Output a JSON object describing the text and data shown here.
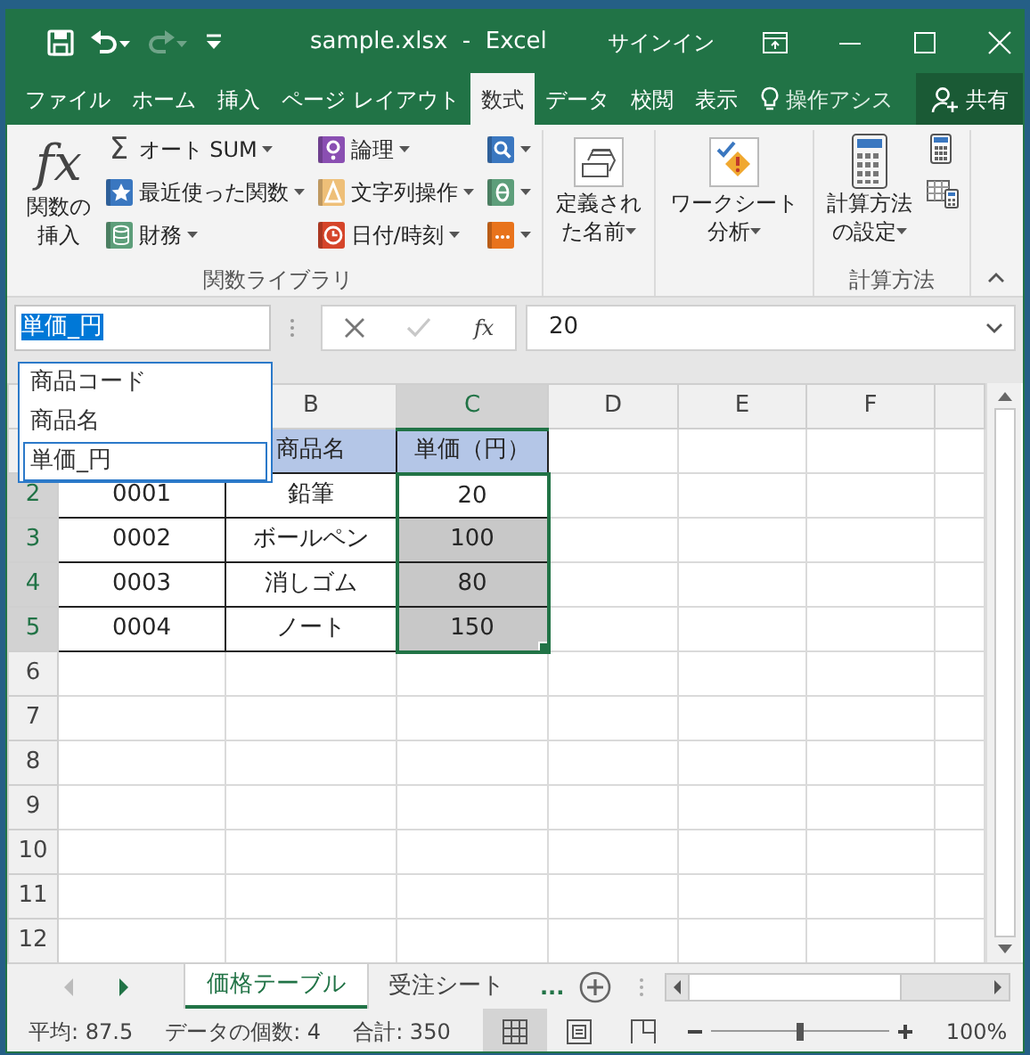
{
  "quick_access": [
    {
      "kind": "save",
      "disabled": false
    },
    {
      "kind": "undo",
      "disabled": false
    },
    {
      "kind": "redo",
      "disabled": true
    },
    {
      "kind": "customize",
      "disabled": false
    }
  ],
  "window": {
    "title": "sample.xlsx  -  Excel",
    "sign_in": "サインイン"
  },
  "tabs": [
    {
      "label": "ファイル",
      "selected": false
    },
    {
      "label": "ホーム",
      "selected": false
    },
    {
      "label": "挿入",
      "selected": false
    },
    {
      "label": "ページ レイアウト",
      "selected": false
    },
    {
      "label": "数式",
      "selected": true
    },
    {
      "label": "データ",
      "selected": false
    },
    {
      "label": "校閲",
      "selected": false
    },
    {
      "label": "表示",
      "selected": false
    }
  ],
  "tell_me": "操作アシス",
  "share": "共有",
  "ribbon": {
    "groups": [
      {
        "label": "関数ライブラリ",
        "items": [
          {
            "kind": "fx",
            "glyph": "fx",
            "label": "関数の挿入"
          },
          {
            "kind": "column",
            "items": [
              {
                "kind": "sum",
                "glyph": "Σ",
                "label": "オート SUM",
                "dropdown": true
              },
              {
                "kind": "star",
                "color": "#3a77c0",
                "label": "最近使った関数",
                "dropdown": true
              },
              {
                "kind": "stack",
                "color": "#5d9e7a",
                "label": "財務",
                "dropdown": true
              }
            ]
          },
          {
            "kind": "column",
            "items": [
              {
                "kind": "ring",
                "color": "#8a4fb2",
                "label": "論理",
                "dropdown": true
              },
              {
                "kind": "triangle",
                "color": "#eebf78",
                "label": "文字列操作",
                "dropdown": true
              },
              {
                "kind": "clock",
                "color": "#d5452a",
                "label": "日付/時刻",
                "dropdown": true
              }
            ]
          },
          {
            "kind": "column",
            "items": [
              {
                "kind": "search",
                "color": "#3a77c0",
                "dropdown": true
              },
              {
                "kind": "ellipse",
                "color": "#5d9e7a",
                "dropdown": true
              },
              {
                "kind": "dots",
                "color": "#e8731c",
                "dropdown": true
              }
            ]
          }
        ]
      },
      {
        "items": [
          {
            "kind": "names",
            "label": "定義された名前",
            "dropdown": true
          }
        ]
      },
      {
        "items": [
          {
            "kind": "audit",
            "label": "ワークシート分析",
            "dropdown": true
          }
        ]
      },
      {
        "label": "計算方法",
        "items": [
          {
            "kind": "calculator",
            "label": "計算方法の設定",
            "dropdown": true
          },
          {
            "kind": "column",
            "items": [
              {
                "kind": "calc-small"
              },
              {
                "kind": "sheet-calc"
              }
            ]
          }
        ]
      }
    ]
  },
  "name_box": {
    "value": "単価_円",
    "highlighted": true
  },
  "name_list": [
    {
      "label": "商品コード",
      "selected": false
    },
    {
      "label": "商品名",
      "selected": false
    },
    {
      "label": "単価_円",
      "selected": true
    }
  ],
  "formula_bar": {
    "cancel_disabled": false,
    "enter_disabled": true,
    "fx": "fx",
    "value": "20"
  },
  "columns": [
    null,
    {
      "label": "B",
      "selected": false
    },
    {
      "label": "C",
      "selected": true
    },
    {
      "label": "D",
      "selected": false
    },
    {
      "label": "E",
      "selected": false
    },
    {
      "label": "F",
      "selected": false
    },
    {
      "selected": false
    }
  ],
  "rows": [
    {
      "cells": [
        null,
        {
          "kind": "header",
          "text": "商品名",
          "selected": false
        },
        {
          "kind": "header",
          "text": "単価（円）",
          "selected": false
        }
      ]
    },
    {
      "label": "2",
      "selected": true,
      "cells": [
        {
          "kind": "data",
          "text": "0001",
          "selected": false
        },
        {
          "kind": "data",
          "text": "鉛筆",
          "selected": false
        },
        {
          "kind": "data",
          "text": "20",
          "selected": true,
          "active": true
        }
      ]
    },
    {
      "label": "3",
      "selected": true,
      "cells": [
        {
          "kind": "data",
          "text": "0002",
          "selected": false
        },
        {
          "kind": "data",
          "text": "ボールペン",
          "selected": false
        },
        {
          "kind": "data",
          "text": "100",
          "selected": true,
          "active": false
        }
      ]
    },
    {
      "label": "4",
      "selected": true,
      "cells": [
        {
          "kind": "data",
          "text": "0003",
          "selected": false
        },
        {
          "kind": "data",
          "text": "消しゴム",
          "selected": false
        },
        {
          "kind": "data",
          "text": "80",
          "selected": true,
          "active": false
        }
      ]
    },
    {
      "label": "5",
      "selected": true,
      "cells": [
        {
          "kind": "data",
          "text": "0004",
          "selected": false
        },
        {
          "kind": "data",
          "text": "ノート",
          "selected": false
        },
        {
          "kind": "data",
          "text": "150",
          "selected": true,
          "active": false
        }
      ]
    },
    {
      "label": "6",
      "selected": false
    },
    {
      "label": "7",
      "selected": false
    },
    {
      "label": "8",
      "selected": false
    },
    {
      "label": "9",
      "selected": false
    },
    {
      "label": "10",
      "selected": false
    },
    {
      "label": "11",
      "selected": false
    },
    {
      "label": "12",
      "selected": false
    }
  ],
  "sheet_nav": [
    {
      "kind": "prev",
      "disabled": true
    },
    {
      "kind": "next",
      "disabled": false
    }
  ],
  "sheets": [
    {
      "label": "価格テーブル",
      "selected": true
    },
    {
      "label": "受注シート",
      "selected": false
    }
  ],
  "more_sheets": "...",
  "status": {
    "stats": [
      "平均: 87.5",
      "データの個数: 4",
      "合計: 350"
    ],
    "views": [
      {
        "kind": "normal",
        "selected": true
      },
      {
        "kind": "page-layout",
        "selected": false
      },
      {
        "kind": "page-break",
        "selected": false
      }
    ],
    "zoom": {
      "level": 0.5,
      "reading": "100%"
    }
  }
}
